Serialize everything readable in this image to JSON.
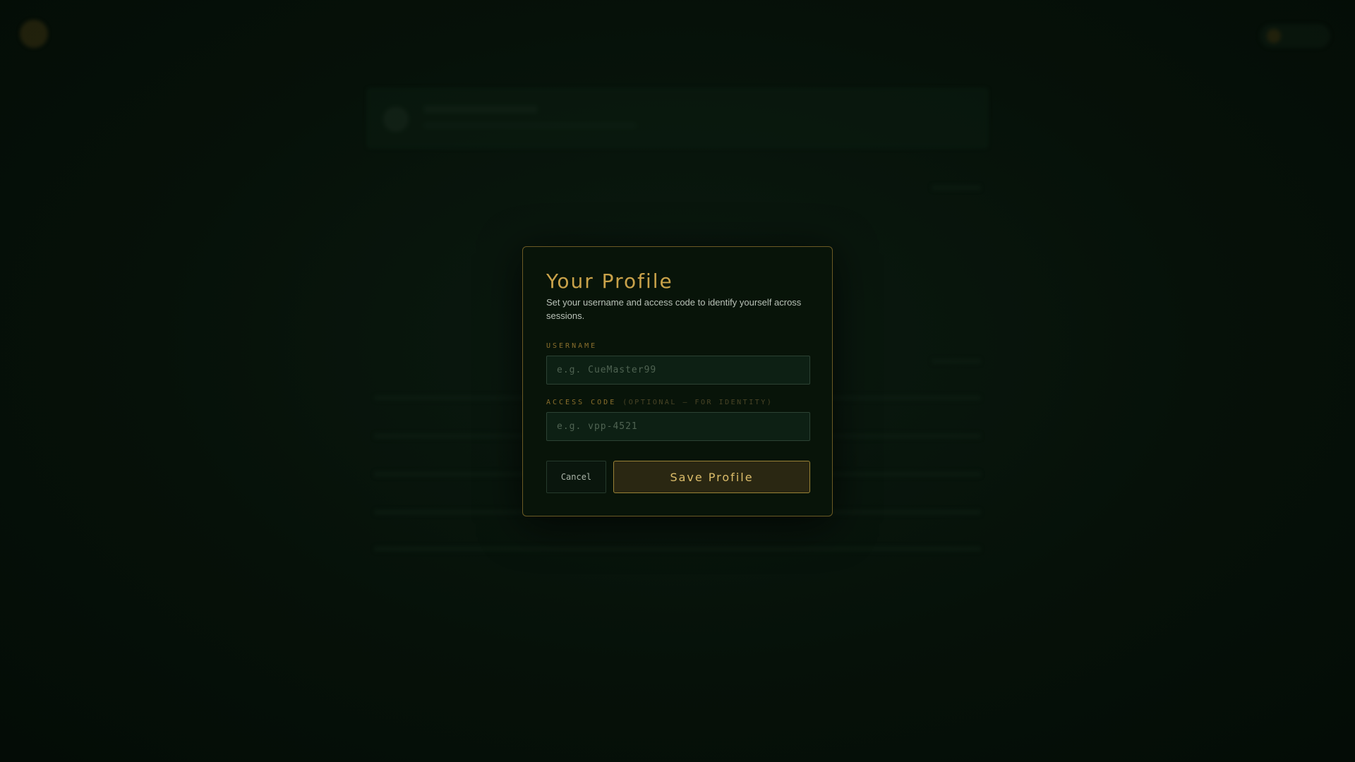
{
  "modal": {
    "title": "Your Profile",
    "description": "Set your username and access code to identify yourself across sessions.",
    "username_label": "USERNAME",
    "username_placeholder": "e.g. CueMaster99",
    "username_value": "",
    "access_code_label": "ACCESS CODE",
    "access_code_hint": "(OPTIONAL — FOR IDENTITY)",
    "access_code_placeholder": "e.g. vpp-4521",
    "access_code_value": "",
    "cancel_label": "Cancel",
    "save_label": "Save Profile"
  },
  "colors": {
    "accent_gold": "#c9a24a",
    "background": "#061209",
    "modal_border": "#6b5a24"
  },
  "icons": {
    "brand_logo": "logo-icon",
    "user_avatar": "avatar-icon"
  }
}
